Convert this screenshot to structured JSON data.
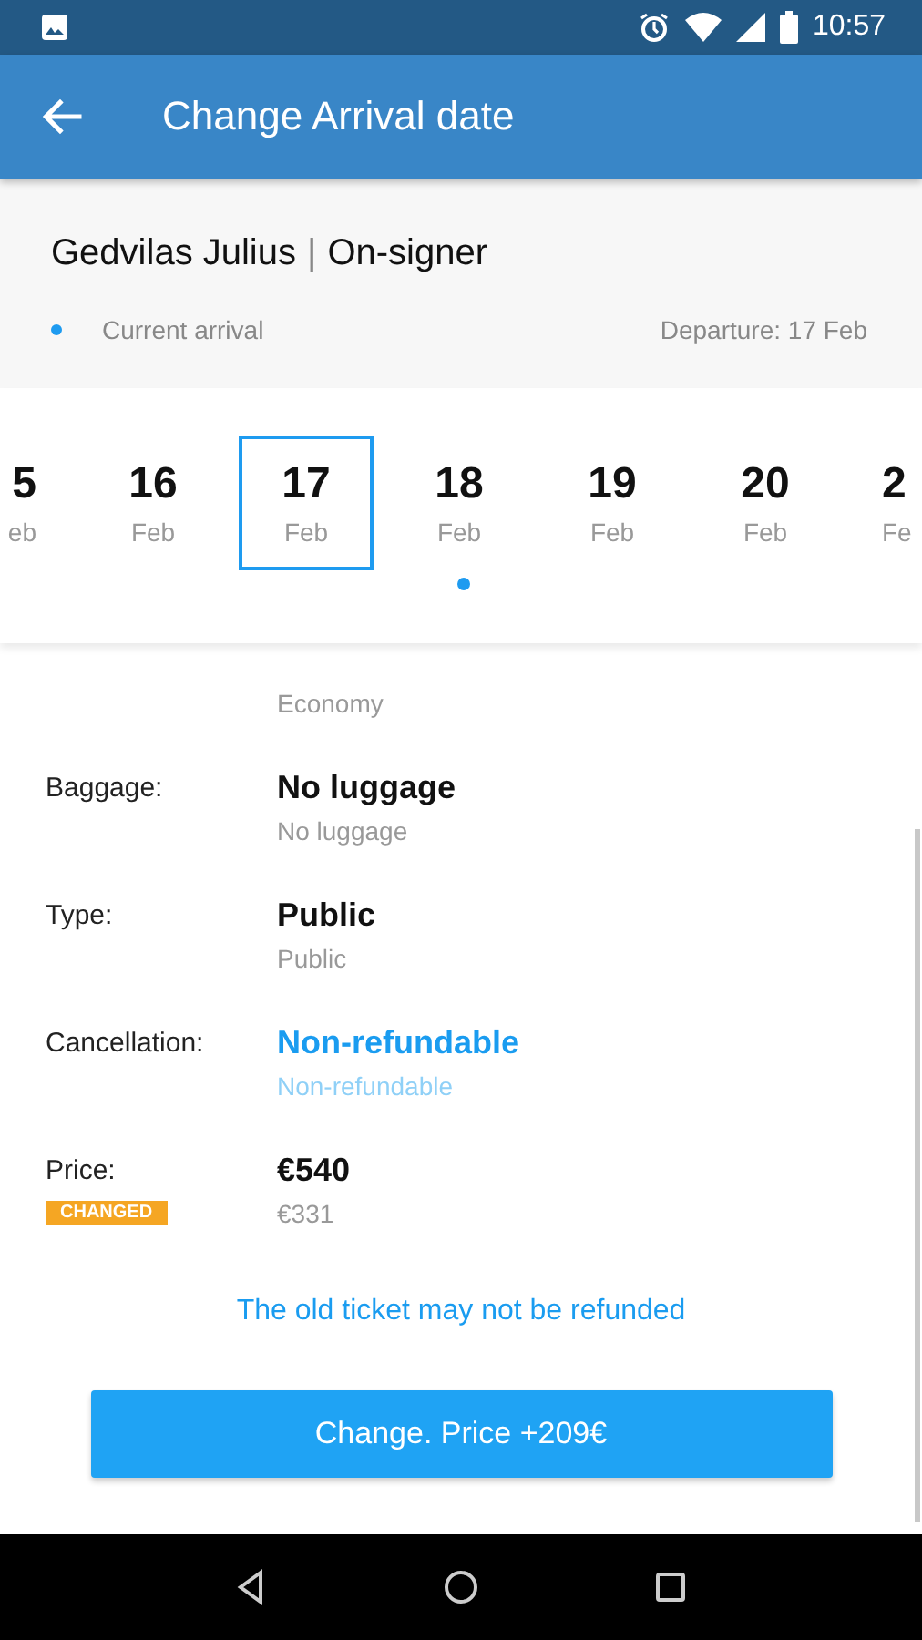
{
  "status_bar": {
    "time": "10:57"
  },
  "app_bar": {
    "title": "Change Arrival date"
  },
  "header": {
    "name": "Gedvilas Julius",
    "separator": "|",
    "role": "On-signer",
    "legend": "Current arrival",
    "departure": "Departure: 17 Feb"
  },
  "dates": [
    {
      "day": "5",
      "month": "eb",
      "selected": false,
      "kind": "cut_left"
    },
    {
      "day": "16",
      "month": "Feb",
      "selected": false,
      "kind": "full"
    },
    {
      "day": "17",
      "month": "Feb",
      "selected": true,
      "kind": "full"
    },
    {
      "day": "18",
      "month": "Feb",
      "selected": false,
      "kind": "full"
    },
    {
      "day": "19",
      "month": "Feb",
      "selected": false,
      "kind": "full"
    },
    {
      "day": "20",
      "month": "Feb",
      "selected": false,
      "kind": "full"
    },
    {
      "day": "2",
      "month": "Fe",
      "selected": false,
      "kind": "cut_right"
    }
  ],
  "details": [
    {
      "sub": "Economy",
      "highlighted": false
    },
    {
      "label": "Baggage:",
      "value": "No luggage",
      "sub": "No luggage",
      "highlighted": false
    },
    {
      "label": "Type:",
      "value": "Public",
      "sub": "Public",
      "highlighted": false
    },
    {
      "label": "Cancellation:",
      "value": "Non-refundable",
      "sub": "Non-refundable",
      "highlighted": true
    },
    {
      "label": "Price:",
      "badge": "CHANGED",
      "value": "€540",
      "sub": "€331",
      "highlighted": false
    }
  ],
  "note": "The old ticket may not be refunded",
  "button": "Change. Price +209€"
}
